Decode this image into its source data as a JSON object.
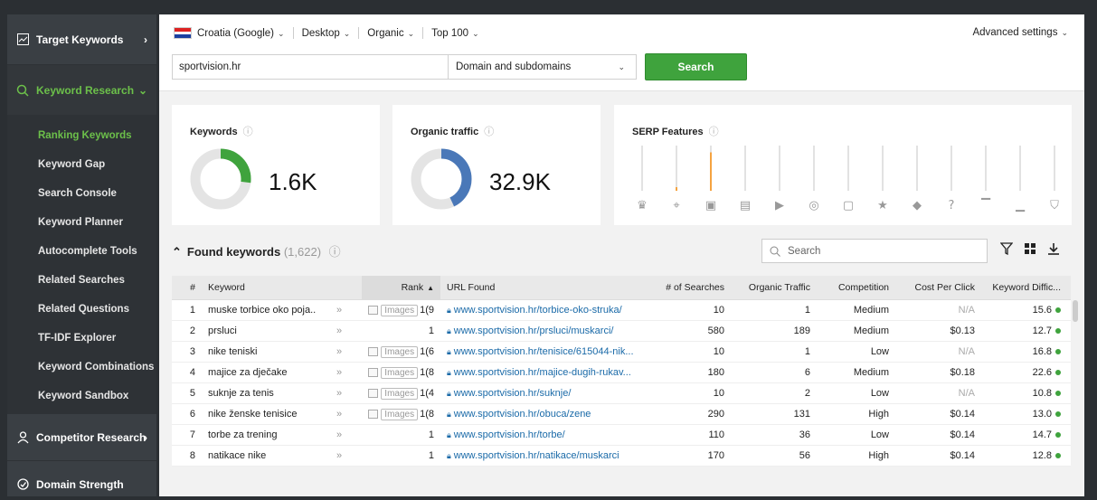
{
  "sidebar": {
    "target_keywords": "Target Keywords",
    "keyword_research": "Keyword Research",
    "items": [
      {
        "label": "Ranking Keywords"
      },
      {
        "label": "Keyword Gap"
      },
      {
        "label": "Search Console"
      },
      {
        "label": "Keyword Planner"
      },
      {
        "label": "Autocomplete Tools"
      },
      {
        "label": "Related Searches"
      },
      {
        "label": "Related Questions"
      },
      {
        "label": "TF-IDF Explorer"
      },
      {
        "label": "Keyword Combinations"
      },
      {
        "label": "Keyword Sandbox"
      }
    ],
    "competitor_research": "Competitor Research",
    "domain_strength": "Domain Strength"
  },
  "filters": {
    "country": "Croatia (Google)",
    "device": "Desktop",
    "type": "Organic",
    "top": "Top 100",
    "advanced": "Advanced settings"
  },
  "search": {
    "domain_value": "sportvision.hr",
    "scope": "Domain and subdomains",
    "button": "Search"
  },
  "cards": {
    "keywords": {
      "title": "Keywords",
      "value": "1.6K"
    },
    "traffic": {
      "title": "Organic traffic",
      "value": "32.9K"
    },
    "serp": {
      "title": "SERP Features"
    }
  },
  "found": {
    "title": "Found keywords",
    "count": "(1,622)",
    "search_placeholder": "Search"
  },
  "table": {
    "headers": {
      "num": "#",
      "keyword": "Keyword",
      "rank": "Rank",
      "url": "URL Found",
      "searches": "# of Searches",
      "traffic": "Organic Traffic",
      "competition": "Competition",
      "cpc": "Cost Per Click",
      "kd": "Keyword Diffic..."
    },
    "rows": [
      {
        "n": "1",
        "kw": "muske torbice oko poja...",
        "img": true,
        "imgtag": "Images",
        "rank": "1(9",
        "url": "www.sportvision.hr/torbice-oko-struka/",
        "s": "10",
        "t": "1",
        "c": "Medium",
        "cpc": "N/A",
        "kd": "15.6"
      },
      {
        "n": "2",
        "kw": "prsluci",
        "img": false,
        "imgtag": "",
        "rank": "1",
        "url": "www.sportvision.hr/prsluci/muskarci/",
        "s": "580",
        "t": "189",
        "c": "Medium",
        "cpc": "$0.13",
        "kd": "12.7"
      },
      {
        "n": "3",
        "kw": "nike teniski",
        "img": true,
        "imgtag": "Images",
        "rank": "1(6",
        "url": "www.sportvision.hr/tenisice/615044-nik...",
        "s": "10",
        "t": "1",
        "c": "Low",
        "cpc": "N/A",
        "kd": "16.8"
      },
      {
        "n": "4",
        "kw": "majice za dječake",
        "img": true,
        "imgtag": "Images",
        "rank": "1(8",
        "url": "www.sportvision.hr/majice-dugih-rukav...",
        "s": "180",
        "t": "6",
        "c": "Medium",
        "cpc": "$0.18",
        "kd": "22.6"
      },
      {
        "n": "5",
        "kw": "suknje za tenis",
        "img": true,
        "imgtag": "Images",
        "rank": "1(4",
        "url": "www.sportvision.hr/suknje/",
        "s": "10",
        "t": "2",
        "c": "Low",
        "cpc": "N/A",
        "kd": "10.8"
      },
      {
        "n": "6",
        "kw": "nike ženske tenisice",
        "img": true,
        "imgtag": "Images",
        "rank": "1(8",
        "url": "www.sportvision.hr/obuca/zene",
        "s": "290",
        "t": "131",
        "c": "High",
        "cpc": "$0.14",
        "kd": "13.0"
      },
      {
        "n": "7",
        "kw": "torbe za trening",
        "img": false,
        "imgtag": "",
        "rank": "1",
        "url": "www.sportvision.hr/torbe/",
        "s": "110",
        "t": "36",
        "c": "Low",
        "cpc": "$0.14",
        "kd": "14.7"
      },
      {
        "n": "8",
        "kw": "natikace nike",
        "img": false,
        "imgtag": "",
        "rank": "1",
        "url": "www.sportvision.hr/natikace/muskarci",
        "s": "170",
        "t": "56",
        "c": "High",
        "cpc": "$0.14",
        "kd": "12.8"
      }
    ]
  },
  "colors": {
    "accent": "#6cc04a",
    "green": "#3fa33d",
    "traffic": "#4a78b8",
    "serp_bar": "#f5a340"
  },
  "donuts": {
    "keywords_fraction": 0.27,
    "traffic_fraction": 0.43
  },
  "serp_bars": [
    {
      "icon": "crown-icon",
      "level": 0
    },
    {
      "icon": "location-icon",
      "level": 0.08
    },
    {
      "icon": "image-icon",
      "level": 0.85
    },
    {
      "icon": "calendar-icon",
      "level": 0
    },
    {
      "icon": "video-icon",
      "level": 0
    },
    {
      "icon": "circle-icon",
      "level": 0
    },
    {
      "icon": "square-icon",
      "level": 0
    },
    {
      "icon": "star-icon",
      "level": 0
    },
    {
      "icon": "graduation-icon",
      "level": 0
    },
    {
      "icon": "question-icon",
      "level": 0
    },
    {
      "icon": "ad-top-icon",
      "level": 0
    },
    {
      "icon": "ad-bottom-icon",
      "level": 0
    },
    {
      "icon": "cart-icon",
      "level": 0
    }
  ]
}
